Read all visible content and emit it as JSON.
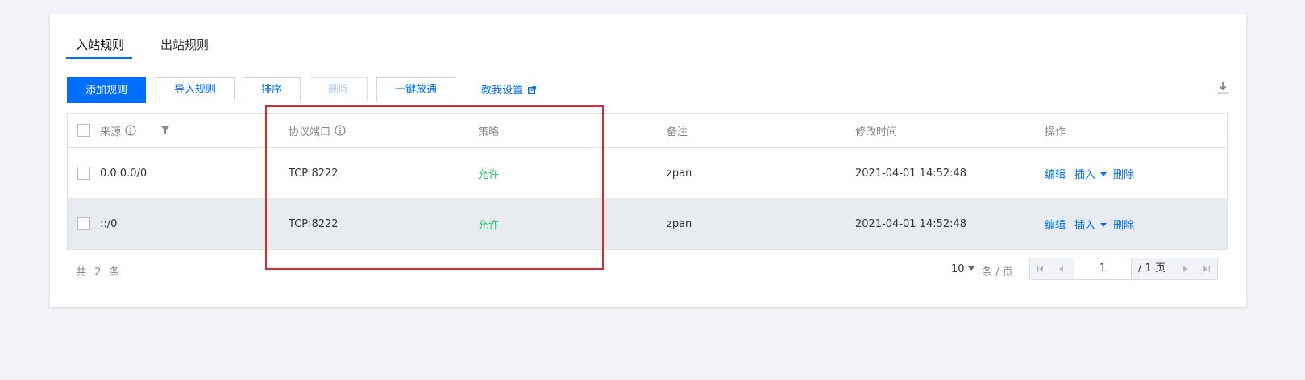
{
  "tabs": [
    {
      "label": "入站规则",
      "active": true
    },
    {
      "label": "出站规则",
      "active": false
    }
  ],
  "toolbar": {
    "add_label": "添加规则",
    "import_label": "导入规则",
    "sort_label": "排序",
    "delete_label": "删除",
    "open_label": "一键放通",
    "help_label": "教我设置",
    "icons": [
      "external-link-icon",
      "download-icon"
    ]
  },
  "table": {
    "headers": {
      "source": "来源",
      "port": "协议端口",
      "policy": "策略",
      "note": "备注",
      "modified": "修改时间",
      "actions": "操作"
    },
    "rows": [
      {
        "source": "0.0.0.0/0",
        "port": "TCP:8222",
        "policy": "允许",
        "note": "zpan",
        "modified": "2021-04-01 14:52:48",
        "edit": "编辑",
        "insert": "插入",
        "delete": "删除"
      },
      {
        "source": "::/0",
        "port": "TCP:8222",
        "policy": "允许",
        "note": "zpan",
        "modified": "2021-04-01 14:52:48",
        "edit": "编辑",
        "insert": "插入",
        "delete": "删除"
      }
    ]
  },
  "footer": {
    "total": "共 2 条",
    "page_size": "10",
    "page_unit": "条 / 页",
    "current_page": "1",
    "total_pages": "/ 1 页"
  },
  "colors": {
    "primary": "#006eff",
    "allow": "#29cc6a",
    "highlight": "#e8262c"
  }
}
